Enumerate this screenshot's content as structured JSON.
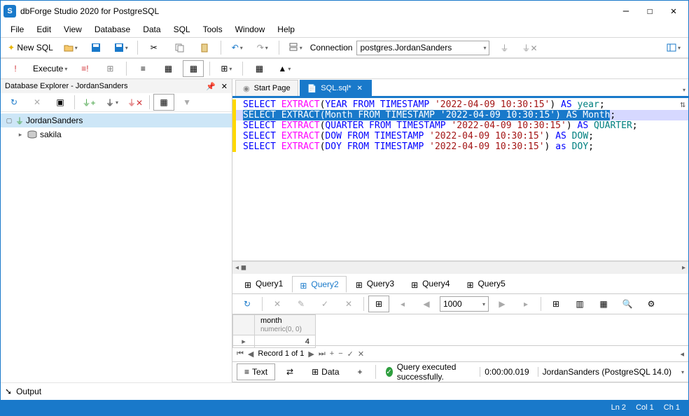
{
  "title": "dbForge Studio 2020 for PostgreSQL",
  "menu": [
    "File",
    "Edit",
    "View",
    "Database",
    "Data",
    "SQL",
    "Tools",
    "Window",
    "Help"
  ],
  "toolbar1": {
    "newsql": "New SQL",
    "conn_label": "Connection",
    "conn_value": "postgres.JordanSanders"
  },
  "toolbar2": {
    "execute": "Execute"
  },
  "explorer": {
    "title": "Database Explorer - JordanSanders",
    "root": "JordanSanders",
    "child": "sakila"
  },
  "tabs": {
    "start": "Start Page",
    "sql": "SQL.sql*"
  },
  "code": [
    {
      "sel": false,
      "tokens": [
        [
          "k",
          "SELECT"
        ],
        [
          "",
          " "
        ],
        [
          "f",
          "EXTRACT"
        ],
        [
          "",
          "("
        ],
        [
          "k",
          "YEAR"
        ],
        [
          "",
          " "
        ],
        [
          "k",
          "FROM"
        ],
        [
          "",
          " "
        ],
        [
          "k",
          "TIMESTAMP"
        ],
        [
          "",
          " "
        ],
        [
          "s",
          "'2022-04-09 10:30:15'"
        ],
        [
          "",
          ") "
        ],
        [
          "k",
          "AS"
        ],
        [
          "",
          " "
        ],
        [
          "i",
          "year"
        ],
        [
          "",
          ";"
        ]
      ]
    },
    {
      "sel": true,
      "text": "SELECT EXTRACT(Month FROM TIMESTAMP '2022-04-09 10:30:15') AS Month",
      "tail": ";"
    },
    {
      "sel": false,
      "tokens": [
        [
          "k",
          "SELECT"
        ],
        [
          "",
          " "
        ],
        [
          "f",
          "EXTRACT"
        ],
        [
          "",
          "("
        ],
        [
          "k",
          "QUARTER"
        ],
        [
          "",
          " "
        ],
        [
          "k",
          "FROM"
        ],
        [
          "",
          " "
        ],
        [
          "k",
          "TIMESTAMP"
        ],
        [
          "",
          " "
        ],
        [
          "s",
          "'2022-04-09 10:30:15'"
        ],
        [
          "",
          ") "
        ],
        [
          "k",
          "AS"
        ],
        [
          "",
          " "
        ],
        [
          "i",
          "QUARTER"
        ],
        [
          "",
          ";"
        ]
      ]
    },
    {
      "sel": false,
      "tokens": [
        [
          "k",
          "SELECT"
        ],
        [
          "",
          " "
        ],
        [
          "f",
          "EXTRACT"
        ],
        [
          "",
          "("
        ],
        [
          "k",
          "DOW"
        ],
        [
          "",
          " "
        ],
        [
          "k",
          "FROM"
        ],
        [
          "",
          " "
        ],
        [
          "k",
          "TIMESTAMP"
        ],
        [
          "",
          " "
        ],
        [
          "s",
          "'2022-04-09 10:30:15'"
        ],
        [
          "",
          ") "
        ],
        [
          "k",
          "AS"
        ],
        [
          "",
          " "
        ],
        [
          "i",
          "DOW"
        ],
        [
          "",
          ";"
        ]
      ]
    },
    {
      "sel": false,
      "tokens": [
        [
          "k",
          "SELECT"
        ],
        [
          "",
          " "
        ],
        [
          "f",
          "EXTRACT"
        ],
        [
          "",
          "("
        ],
        [
          "k",
          "DOY"
        ],
        [
          "",
          " "
        ],
        [
          "k",
          "FROM"
        ],
        [
          "",
          " "
        ],
        [
          "k",
          "TIMESTAMP"
        ],
        [
          "",
          " "
        ],
        [
          "s",
          "'2022-04-09 10:30:15'"
        ],
        [
          "",
          ") "
        ],
        [
          "k",
          "as"
        ],
        [
          "",
          " "
        ],
        [
          "i",
          "DOY"
        ],
        [
          "",
          ";"
        ]
      ]
    }
  ],
  "rtabs": [
    "Query1",
    "Query2",
    "Query3",
    "Query4",
    "Query5"
  ],
  "active_rtab": 1,
  "page_size": "1000",
  "grid": {
    "col": "month",
    "coltype": "numeric(0, 0)",
    "val": "4"
  },
  "record": "Record 1 of 1",
  "bottom": {
    "text": "Text",
    "data": "Data"
  },
  "status": {
    "msg": "Query executed successfully.",
    "time": "0:00:00.019",
    "conn": "JordanSanders (PostgreSQL 14.0)"
  },
  "output": "Output",
  "statusbar": {
    "ln": "Ln 2",
    "col": "Col 1",
    "ch": "Ch 1"
  }
}
